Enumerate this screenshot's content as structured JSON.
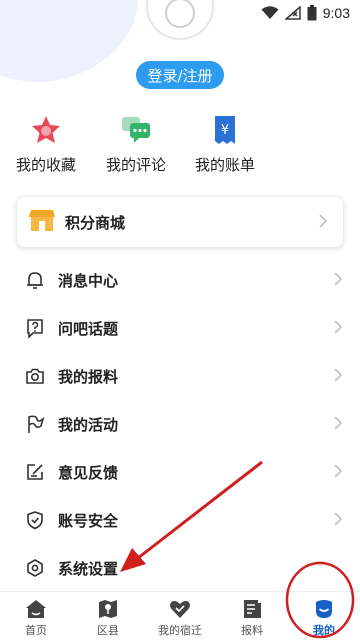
{
  "status_bar": {
    "time": "9:03"
  },
  "profile": {
    "login_label": "登录/注册"
  },
  "shortcuts": [
    {
      "label": "我的收藏",
      "icon": "star-icon"
    },
    {
      "label": "我的评论",
      "icon": "chat-bubbles-icon"
    },
    {
      "label": "我的账单",
      "icon": "bill-icon"
    }
  ],
  "mall": {
    "label": "积分商城",
    "icon": "shop-icon"
  },
  "menu": [
    {
      "label": "消息中心",
      "icon": "bell-icon"
    },
    {
      "label": "问吧话题",
      "icon": "question-icon"
    },
    {
      "label": "我的报料",
      "icon": "camera-icon"
    },
    {
      "label": "我的活动",
      "icon": "flag-icon"
    },
    {
      "label": "意见反馈",
      "icon": "edit-icon"
    },
    {
      "label": "账号安全",
      "icon": "shield-icon"
    },
    {
      "label": "系统设置",
      "icon": "settings-icon"
    }
  ],
  "bottom_nav": [
    {
      "label": "首页",
      "icon": "home-icon"
    },
    {
      "label": "区县",
      "icon": "map-icon"
    },
    {
      "label": "我的宿迁",
      "icon": "heart-icon"
    },
    {
      "label": "报料",
      "icon": "report-icon"
    },
    {
      "label": "我的",
      "icon": "profile-icon",
      "active": true
    }
  ],
  "colors": {
    "accent": "#2d9bf0",
    "active_nav": "#1560c4",
    "annotation": "#d11f1f",
    "star": "#e8495a",
    "chat": "#34b36b",
    "bill": "#2a72d6",
    "shop": "#f2a628"
  }
}
